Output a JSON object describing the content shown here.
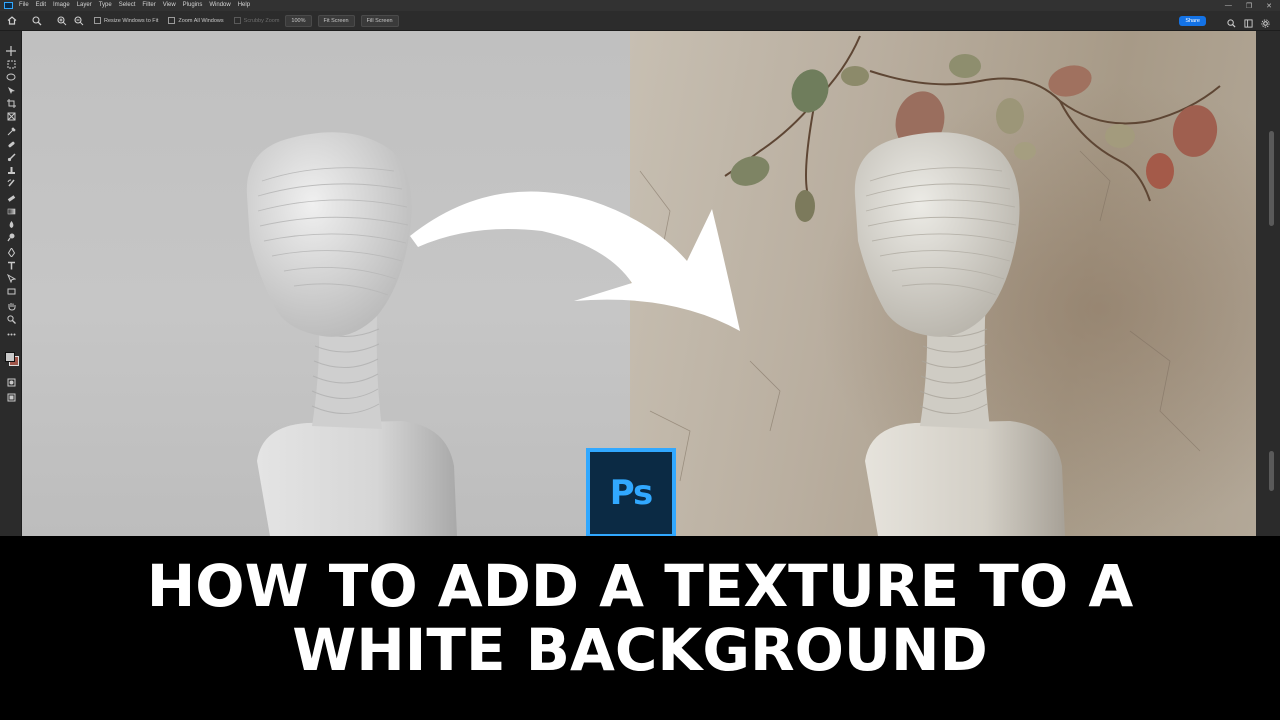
{
  "menu": {
    "items": [
      "File",
      "Edit",
      "Image",
      "Layer",
      "Type",
      "Select",
      "Filter",
      "View",
      "Plugins",
      "Window",
      "Help"
    ]
  },
  "options_bar": {
    "resize_windows_label": "Resize Windows to Fit",
    "zoom_all_windows_label": "Zoom All Windows",
    "scrubby_zoom_label": "Scrubby Zoom",
    "zoom_value": "100%",
    "fit_screen_label": "Fit Screen",
    "fill_screen_label": "Fill Screen",
    "share_label": "Share"
  },
  "toolbar": {
    "tools": [
      "move-tool",
      "artboard-tool",
      "marquee-tool",
      "lasso-tool",
      "object-select-tool",
      "crop-tool",
      "frame-tool",
      "eyedropper-tool",
      "healing-tool",
      "brush-tool",
      "clone-stamp-tool",
      "history-brush-tool",
      "eraser-tool",
      "gradient-tool",
      "blur-tool",
      "dodge-tool",
      "pen-tool",
      "type-tool",
      "path-select-tool",
      "rectangle-tool",
      "hand-tool",
      "zoom-tool",
      "edit-toolbar-tool"
    ],
    "foreground_color": "#c8c8c8",
    "background_color": "#a0564a"
  },
  "overlay": {
    "ps_logo_text": "Ps",
    "title_line1": "HOW TO ADD A TEXTURE TO A",
    "title_line2": "WHITE BACKGROUND"
  },
  "colors": {
    "ps_blue": "#31a8ff",
    "ps_dark": "#0b2a44",
    "share_blue": "#1473e6"
  }
}
